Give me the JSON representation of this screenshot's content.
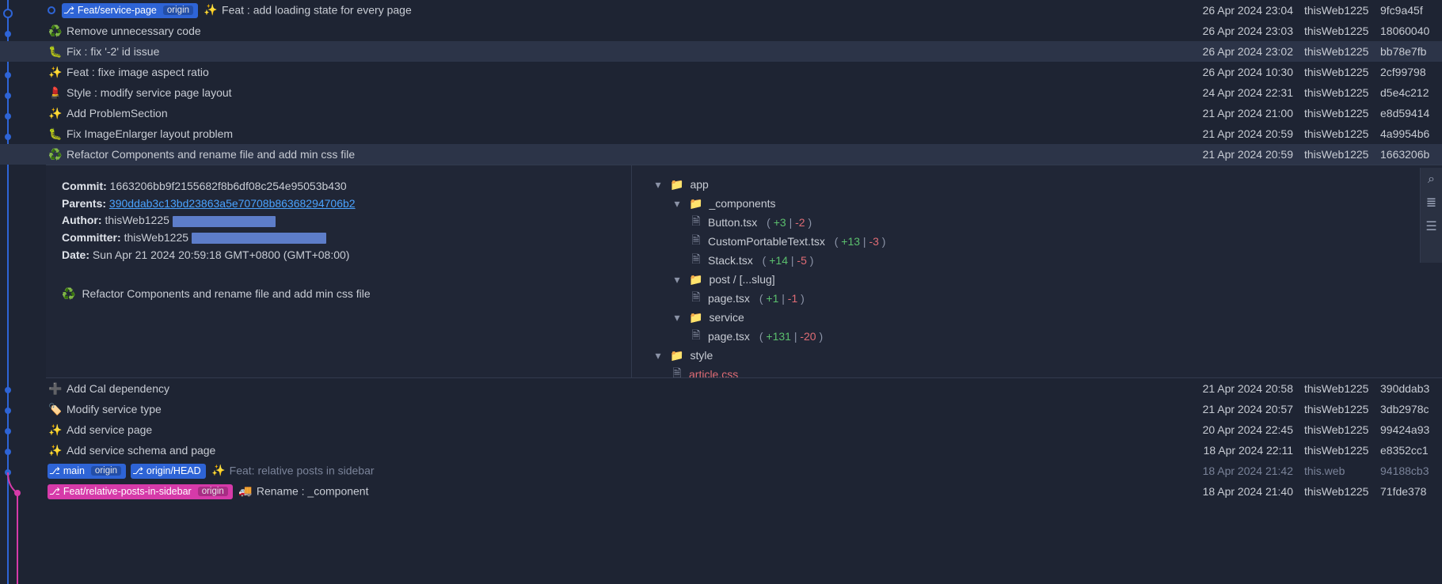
{
  "commits": [
    {
      "branches": [
        {
          "name": "Feat/service-page",
          "origin": "origin",
          "style": "bt-blue",
          "icon": "⎇"
        }
      ],
      "emoji": "✨",
      "msg": "Feat : add loading state for every page",
      "date": "26 Apr 2024 23:04",
      "author": "thisWeb1225",
      "hash": "9fc9a45f",
      "dim": false,
      "head": true
    },
    {
      "emoji": "♻️",
      "msg": "Remove unnecessary code",
      "date": "26 Apr 2024 23:03",
      "author": "thisWeb1225",
      "hash": "18060040"
    },
    {
      "emoji": "🐛",
      "msg": "Fix : fix '-2' id issue",
      "date": "26 Apr 2024 23:02",
      "author": "thisWeb1225",
      "hash": "bb78e7fb",
      "selected": false,
      "hl": true
    },
    {
      "emoji": "✨",
      "msg": "Feat : fixe image aspect ratio",
      "date": "26 Apr 2024 10:30",
      "author": "thisWeb1225",
      "hash": "2cf99798"
    },
    {
      "emoji": "💄",
      "msg": "Style : modify service page layout",
      "date": "24 Apr 2024 22:31",
      "author": "thisWeb1225",
      "hash": "d5e4c212"
    },
    {
      "emoji": "✨",
      "msg": "Add ProblemSection",
      "date": "21 Apr 2024 21:00",
      "author": "thisWeb1225",
      "hash": "e8d59414"
    },
    {
      "emoji": "🐛",
      "msg": "Fix ImageEnlarger layout problem",
      "date": "21 Apr 2024 20:59",
      "author": "thisWeb1225",
      "hash": "4a9954b6"
    },
    {
      "emoji": "♻️",
      "msg": "Refactor Components and rename file and add min css file",
      "date": "21 Apr 2024 20:59",
      "author": "thisWeb1225",
      "hash": "1663206b",
      "selected": true
    }
  ],
  "commits2": [
    {
      "emoji": "➕",
      "msg": "Add Cal dependency",
      "date": "21 Apr 2024 20:58",
      "author": "thisWeb1225",
      "hash": "390ddab3"
    },
    {
      "emoji": "🏷️",
      "msg": "Modify service type",
      "date": "21 Apr 2024 20:57",
      "author": "thisWeb1225",
      "hash": "3db2978c"
    },
    {
      "emoji": "✨",
      "msg": "Add service page",
      "date": "20 Apr 2024 22:45",
      "author": "thisWeb1225",
      "hash": "99424a93"
    },
    {
      "emoji": "✨",
      "msg": "Add service schema and page",
      "date": "18 Apr 2024 22:11",
      "author": "thisWeb1225",
      "hash": "e8352cc1"
    },
    {
      "branches": [
        {
          "name": "main",
          "origin": "origin",
          "style": "bt-blue2",
          "icon": "⎇"
        },
        {
          "name": "origin/HEAD",
          "style": "bt-blue2",
          "icon": "⎇"
        }
      ],
      "emoji": "✨",
      "msg": "Feat: relative posts in sidebar",
      "date": "18 Apr 2024 21:42",
      "author": "this.web",
      "hash": "94188cb3",
      "dim": true
    },
    {
      "branches": [
        {
          "name": "Feat/relative-posts-in-sidebar",
          "origin": "origin",
          "style": "bt-pink",
          "icon": "⎇"
        }
      ],
      "emoji": "🚚",
      "msg": "Rename : _component",
      "date": "18 Apr 2024 21:40",
      "author": "thisWeb1225",
      "hash": "71fde378"
    }
  ],
  "detail": {
    "labels": {
      "commit": "Commit:",
      "parents": "Parents:",
      "author": "Author:",
      "committer": "Committer:",
      "date": "Date:"
    },
    "commit": "1663206bb9f2155682f8b6df08c254e95053b430",
    "parent": "390ddab3c13bd23863a5e70708b86368294706b2",
    "authorName": "thisWeb1225",
    "committerName": "thisWeb1225",
    "date": "Sun Apr 21 2024 20:59:18 GMT+0800 (GMT+08:00)",
    "msgEmoji": "♻️",
    "msg": "Refactor Components and rename file and add min css file"
  },
  "tree": [
    {
      "type": "folder",
      "name": "app",
      "indent": 1
    },
    {
      "type": "folder",
      "name": "_components",
      "indent": 2
    },
    {
      "type": "file",
      "name": "Button.tsx",
      "indent": 3,
      "add": 3,
      "del": 2
    },
    {
      "type": "file",
      "name": "CustomPortableText.tsx",
      "indent": 3,
      "add": 13,
      "del": 3
    },
    {
      "type": "file",
      "name": "Stack.tsx",
      "indent": 3,
      "add": 14,
      "del": 5
    },
    {
      "type": "folder",
      "name": "post / [...slug]",
      "indent": 2
    },
    {
      "type": "file",
      "name": "page.tsx",
      "indent": 3,
      "add": 1,
      "del": 1
    },
    {
      "type": "folder",
      "name": "service",
      "indent": 2
    },
    {
      "type": "file",
      "name": "page.tsx",
      "indent": 3,
      "add": 131,
      "del": 20
    },
    {
      "type": "folder",
      "name": "style",
      "indent": 1
    },
    {
      "type": "file",
      "name": "article.css",
      "indent": 2,
      "deleted": true
    }
  ],
  "rail": {
    "close": "×",
    "search": "⌕",
    "list": "≣",
    "tree": "☰"
  }
}
